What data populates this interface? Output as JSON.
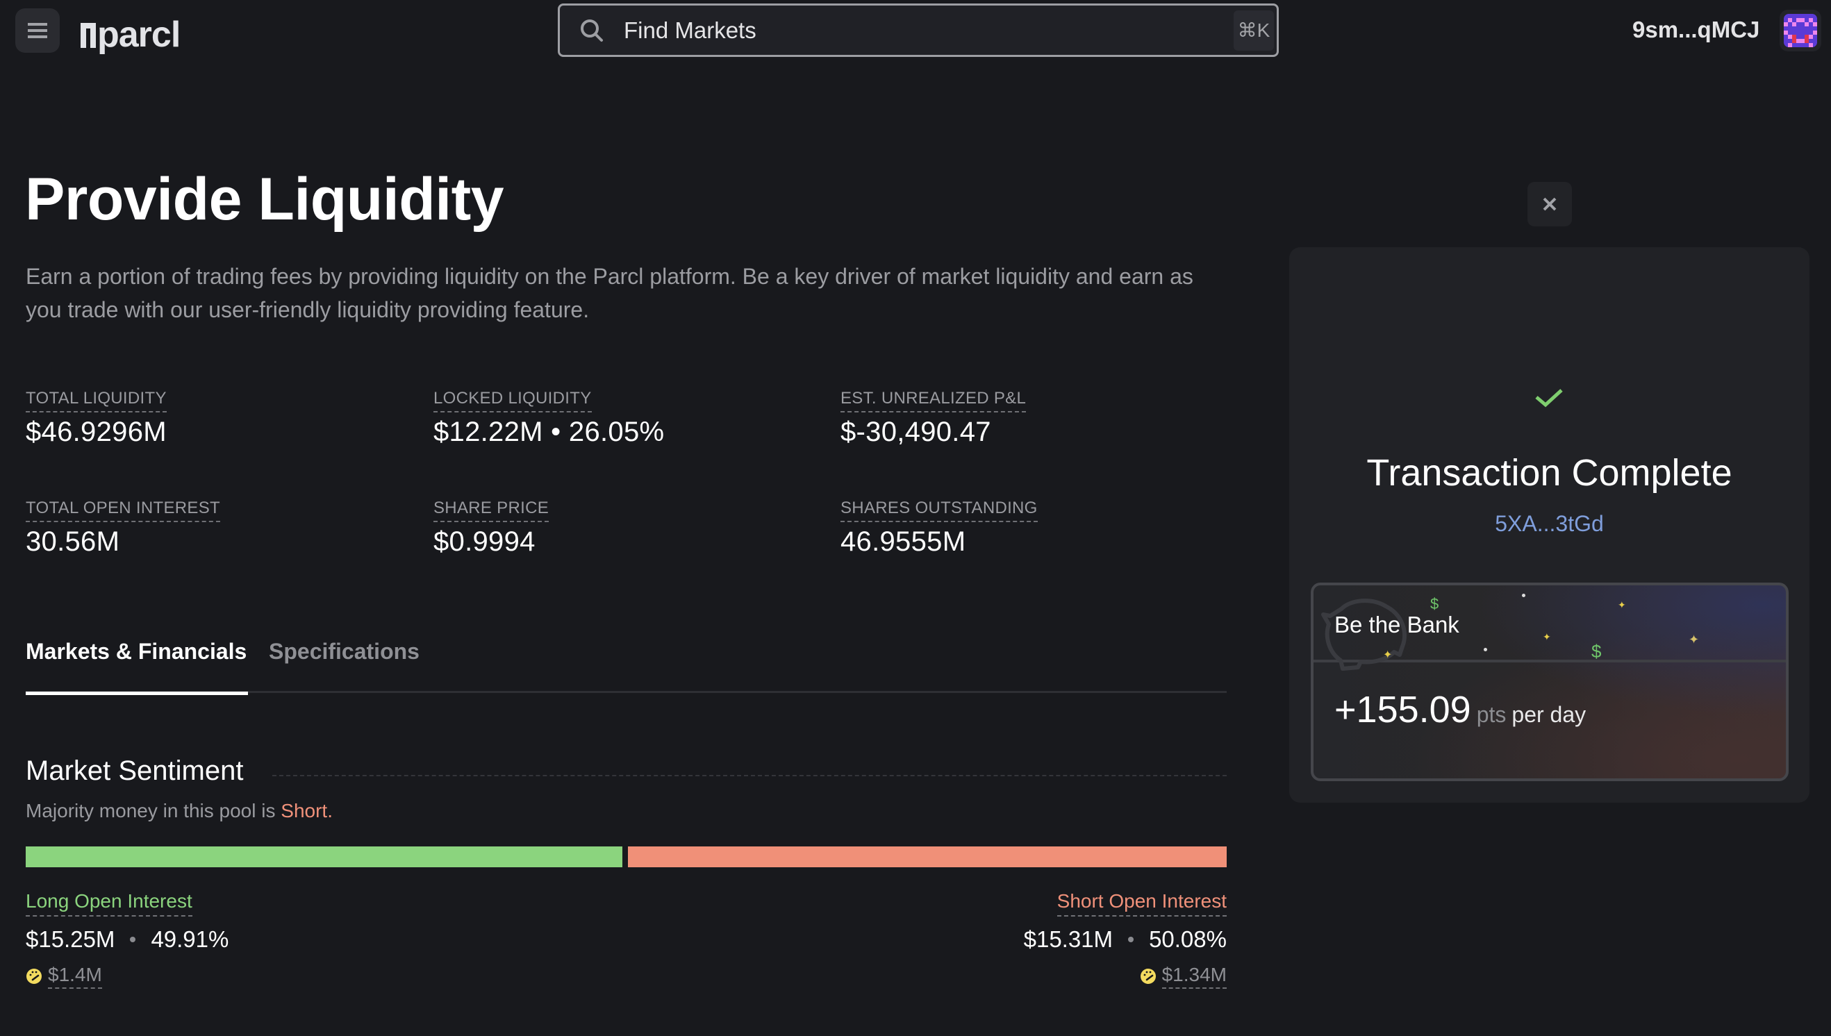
{
  "header": {
    "menu_icon": "hamburger-menu-icon",
    "logo_text": "parcl",
    "search": {
      "placeholder": "Find Markets",
      "value": "",
      "shortcut": "⌘K"
    },
    "wallet_address": "9sm...qMCJ",
    "avatar_icon": "pixel-avatar-icon"
  },
  "page": {
    "title": "Provide Liquidity",
    "description": "Earn a portion of trading fees by providing liquidity on the Parcl platform. Be a key driver of market liquidity and earn as you trade with our user-friendly liquidity providing feature."
  },
  "stats": [
    {
      "label": "TOTAL LIQUIDITY",
      "value": "$46.9296M"
    },
    {
      "label": "LOCKED LIQUIDITY",
      "value": "$12.22M • 26.05%"
    },
    {
      "label": "EST. UNREALIZED P&L",
      "value": "$-30,490.47"
    },
    {
      "label": "TOTAL OPEN INTEREST",
      "value": "30.56M"
    },
    {
      "label": "SHARE PRICE",
      "value": "$0.9994"
    },
    {
      "label": "SHARES OUTSTANDING",
      "value": "46.9555M"
    }
  ],
  "tabs": [
    {
      "label": "Markets & Financials",
      "active": true
    },
    {
      "label": "Specifications",
      "active": false
    }
  ],
  "sentiment": {
    "title": "Market Sentiment",
    "subtitle_prefix": "Majority money in this pool is ",
    "subtitle_highlight": "Short.",
    "long_fraction": 0.4991,
    "short_fraction": 0.5008,
    "long": {
      "label": "Long Open Interest",
      "amount": "$15.25M",
      "percent": "49.91%",
      "fee": "$1.4M"
    },
    "short": {
      "label": "Short Open Interest",
      "amount": "$15.31M",
      "percent": "50.08%",
      "fee": "$1.34M"
    },
    "colors": {
      "long": "#8bd47e",
      "short": "#f09078"
    }
  },
  "panel": {
    "close_icon": "close-icon",
    "status_icon": "checkmark-icon",
    "title": "Transaction Complete",
    "tx_hash": "5XA...3tGd",
    "bank_card": {
      "title": "Be the Bank",
      "points": "+155.09",
      "unit": "pts",
      "period": "per day"
    }
  }
}
